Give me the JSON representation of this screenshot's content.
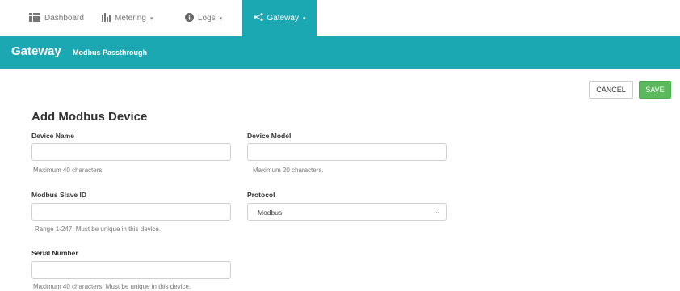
{
  "nav": {
    "dashboard": "Dashboard",
    "metering": "Metering",
    "logs": "Logs",
    "gateway": "Gateway"
  },
  "header": {
    "title": "Gateway",
    "subtitle": "Modbus Passthrough"
  },
  "actions": {
    "cancel": "CANCEL",
    "save": "SAVE"
  },
  "form": {
    "title": "Add Modbus Device",
    "device_name": {
      "label": "Device Name",
      "value": "",
      "help": "Maximum 40 characters"
    },
    "device_model": {
      "label": "Device Model",
      "value": "",
      "help": "Maximum 20 characters."
    },
    "slave_id": {
      "label": "Modbus Slave ID",
      "value": "",
      "help": "Range 1-247. Must be unique in this device."
    },
    "protocol": {
      "label": "Protocol",
      "selected": "Modbus"
    },
    "serial_number": {
      "label": "Serial Number",
      "value": "",
      "help": "Maximum 40 characters. Must be unique in this device."
    }
  },
  "colors": {
    "accent": "#1ba8b2",
    "save": "#5cb85c"
  }
}
